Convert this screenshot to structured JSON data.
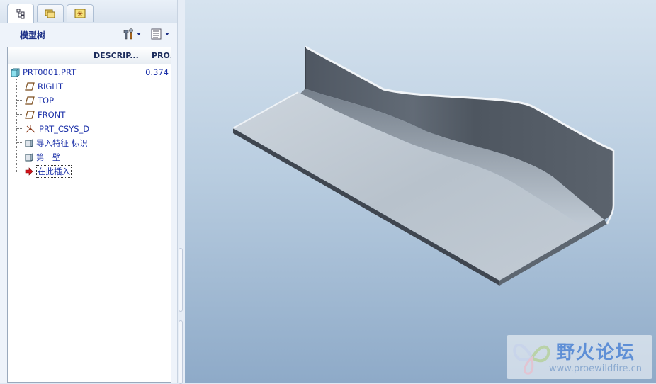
{
  "panel": {
    "title": "模型树",
    "tabs": [
      {
        "icon": "model-tree-icon"
      },
      {
        "icon": "folder-browser-icon"
      },
      {
        "icon": "favorites-icon"
      }
    ],
    "toolbar": [
      {
        "icon": "settings-tools-icon"
      },
      {
        "icon": "show-list-icon"
      }
    ]
  },
  "tree": {
    "columns": [
      "DESCRIP...",
      "PRO..."
    ],
    "root": {
      "label": "PRT0001.PRT",
      "value": "0.374"
    },
    "items": [
      {
        "label": "RIGHT",
        "icon": "datum-plane-icon"
      },
      {
        "label": "TOP",
        "icon": "datum-plane-icon"
      },
      {
        "label": "FRONT",
        "icon": "datum-plane-icon"
      },
      {
        "label": "PRT_CSYS_D",
        "icon": "coordinate-system-icon"
      },
      {
        "label": "导入特征 标识",
        "icon": "feature-icon"
      },
      {
        "label": "第一壁",
        "icon": "feature-icon"
      },
      {
        "label": "在此插入",
        "icon": "insert-here-arrow-icon"
      }
    ]
  },
  "watermark": {
    "title": "野火论坛",
    "url": "www.proewildfire.cn"
  },
  "colors": {
    "tree_text": "#1a2fa8",
    "panel_title": "#1c2f86",
    "viewport_top": "#d6e3ef",
    "viewport_bottom": "#8eaac8"
  }
}
